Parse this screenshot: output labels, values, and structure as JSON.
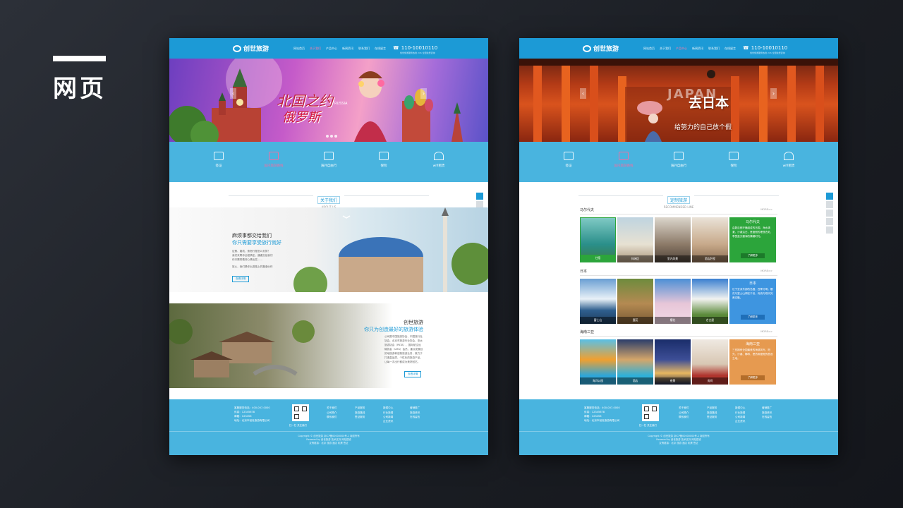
{
  "section_label": "网页",
  "brand": {
    "name": "创世旅游",
    "phone": "110-10010110",
    "phone_sub": "创世旅游服务热线 24h 全国免费咨询"
  },
  "nav_items": [
    "网站首页",
    "关于我们",
    "产品中心",
    "新闻资讯",
    "联系我们",
    "在线留言"
  ],
  "services": [
    "签证",
    "国内旅游路线",
    "海外自由行",
    "保险",
    "wifi租赁"
  ],
  "page_a": {
    "active_nav": 1,
    "banner": {
      "title": "北国之约",
      "subtitle": "俄罗斯",
      "tag": "RUSSIA"
    },
    "section": {
      "cn": "关于我们",
      "en": "ABOUT US"
    },
    "about1": {
      "heading": "麻烦事都交给我们",
      "subheading": "你只需要享受旅行就好",
      "lines": [
        "证照、路线、食宿行程怎么安排？",
        "我们来帮你全程搞定，通通交给我们",
        "你只需带着好心情出发……"
      ],
      "note": "放心，我们是你出游路上的靠谱伙伴",
      "button": "查看详情"
    },
    "about2": {
      "heading": "创世旅游",
      "subheading": "你只为创造最好的旅游体验",
      "body": "公司是中国旅游协会、中国旅行社协会、北京市旅游行业协会、亚太旅游协会（PATA）、国际航空运输协会（IATA）会员，重点发展目的地旅游和定制旅游业务，致力于打造高品质、个性化的旅游产品，让每一次出行都成为美好回忆。",
      "button": "查看详情"
    }
  },
  "page_b": {
    "active_nav": 2,
    "banner": {
      "title": "去日本",
      "subtitle": "给努力的自己放个假",
      "tag": "JAPAN"
    },
    "section": {
      "cn": "定制旅游",
      "en": "RECOMMENDED LINE"
    },
    "more_label": "MORE>>",
    "categories": [
      {
        "name": "马尔代夫",
        "tiles": [
          "住宿",
          "休闲区",
          "室内风景",
          "酒店卧室"
        ],
        "info_title": "马尔代夫",
        "info_text": "由数百座环礁组成的岛国，海水清澈，沙滩洁白，是度假的理想去处，享受蓝天碧海的慵懒时光。",
        "button": "了解更多",
        "info_color": "#2ca53b"
      },
      {
        "name": "日本",
        "tiles": [
          "富士山",
          "鹿苑",
          "樱花",
          "名古屋"
        ],
        "info_title": "日本",
        "info_text": "位于亚洲东部的岛国，四季分明，樱花与富士山闻名于世，传统与现代完美交融。",
        "button": "了解更多",
        "info_color": "#3e95e0"
      },
      {
        "name": "海南三亚",
        "tiles": [
          "海洋公园",
          "酒店",
          "夜景",
          "房间"
        ],
        "info_title": "海南三亚",
        "info_text": "三亚拥有全国最美的海滨风光，阳光、沙滩、椰林，是热带度假的首选之地。",
        "button": "了解更多",
        "info_color": "#e69a50"
      }
    ]
  },
  "footer": {
    "contacts": [
      "客服服务电话：400-007-0000",
      "传真：12345678",
      "邮箱：123456",
      "地址：北京市创世旅游有限公司"
    ],
    "qr_caption": "扫一扫 关注我们",
    "columns": [
      {
        "title": "关于我们",
        "items": [
          "公司简介",
          "联系我们"
        ]
      },
      {
        "title": "产品服务",
        "items": [
          "旅游路线",
          "签证服务"
        ]
      },
      {
        "title": "新闻中心",
        "items": [
          "行业新闻",
          "公司新闻",
          "企业资讯"
        ]
      },
      {
        "title": "营销推广",
        "items": [
          "旅游资讯",
          "在线留言"
        ]
      }
    ],
    "copyright": "Copyright © 创世旅游 京ICP备00000000号-1 版权所有",
    "powered": "Powered by 创世旅游 技术支持 网站建设",
    "links": "友情链接：北京 旅游 酒店 机票 签证"
  }
}
